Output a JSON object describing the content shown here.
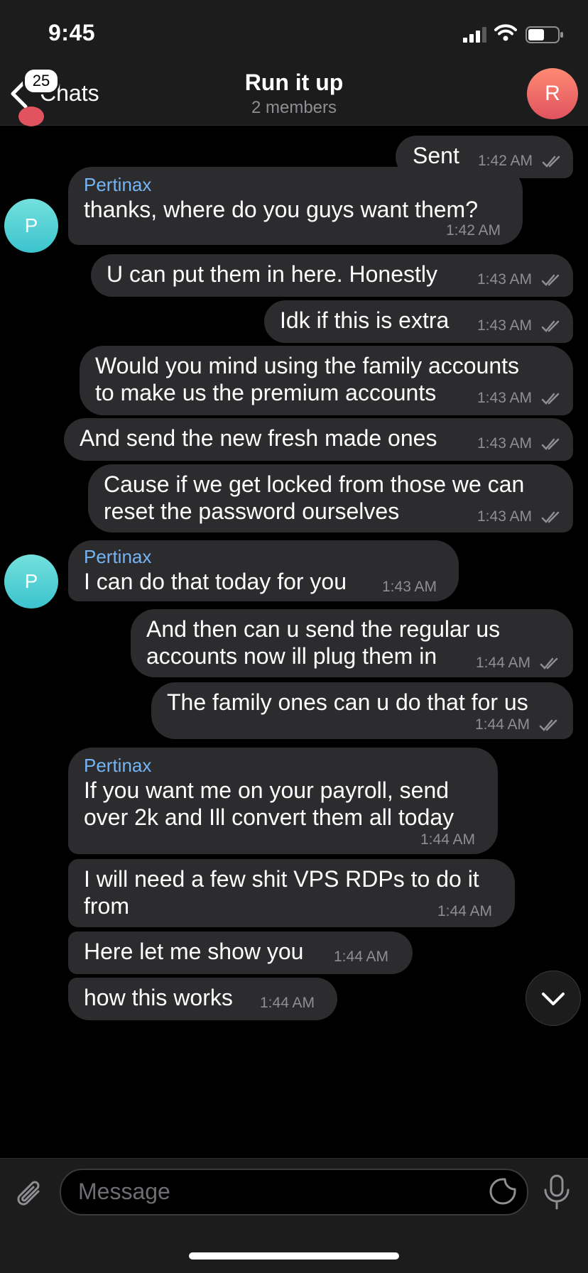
{
  "status_bar": {
    "time": "9:45"
  },
  "header": {
    "back_label": "Chats",
    "unread_badge": "25",
    "title": "Run it up",
    "subtitle": "2 members",
    "avatar_initial": "R",
    "avatar_color": "#e0535f"
  },
  "messages": [
    {
      "dir": "out",
      "text": "Sent",
      "time": "1:42 AM"
    },
    {
      "dir": "in",
      "sender": "Pertinax",
      "text": "thanks, where do you guys want them?",
      "time": "1:42 AM",
      "avatar": "P"
    },
    {
      "dir": "out",
      "text": "U can put them in here. Honestly",
      "time": "1:43 AM"
    },
    {
      "dir": "out",
      "text": "Idk if this is extra",
      "time": "1:43 AM"
    },
    {
      "dir": "out",
      "lines": [
        "Would you mind using the family accounts",
        "to make us the premium accounts"
      ],
      "time": "1:43 AM"
    },
    {
      "dir": "out",
      "text": "And send the new fresh made ones",
      "time": "1:43 AM"
    },
    {
      "dir": "out",
      "lines": [
        "Cause if we get locked from those we can",
        "reset the password ourselves"
      ],
      "time": "1:43 AM"
    },
    {
      "dir": "in",
      "sender": "Pertinax",
      "text": "I can do that today for you",
      "time": "1:43 AM",
      "avatar": "P"
    },
    {
      "dir": "out",
      "lines": [
        "And then can u send the regular us",
        "accounts now ill plug them in"
      ],
      "time": "1:44 AM"
    },
    {
      "dir": "out",
      "text": "The family ones can u do that for us",
      "time": "1:44 AM"
    },
    {
      "dir": "in",
      "sender": "Pertinax",
      "lines": [
        "If you want me on your payroll, send",
        "over 2k and Ill convert them all today"
      ],
      "time": "1:44 AM"
    },
    {
      "dir": "in",
      "lines": [
        "I will need a few shit VPS RDPs to do it",
        "from"
      ],
      "time": "1:44 AM"
    },
    {
      "dir": "in",
      "text": "Here let me show you",
      "time": "1:44 AM"
    },
    {
      "dir": "in",
      "text": "how this works",
      "time": "1:44 AM"
    }
  ],
  "composer": {
    "placeholder": "Message"
  },
  "colors": {
    "bubble": "#2c2c2e",
    "sender_name": "#74b4f5",
    "incoming_avatar": "#3cc3ce",
    "background": "#000000"
  },
  "icons": [
    "back-chevron-icon",
    "signal-icon",
    "wifi-icon",
    "battery-icon",
    "double-check-icon",
    "scroll-down-icon",
    "attach-icon",
    "sticker-icon",
    "microphone-icon"
  ]
}
